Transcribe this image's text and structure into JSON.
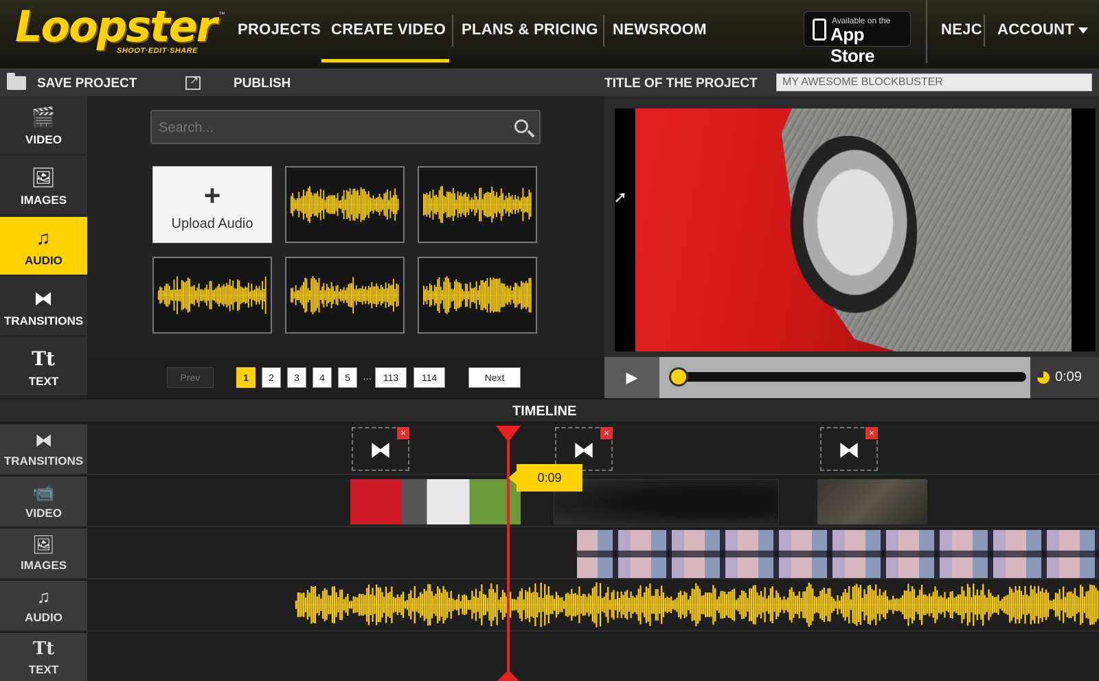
{
  "brand": {
    "logo_text": "Loopster",
    "tagline": "SHOOT·EDIT·SHARE",
    "tm": "™",
    "accent": "#ffd200"
  },
  "nav": {
    "projects": "PROJECTS",
    "create_video": "CREATE VIDEO",
    "plans_pricing": "PLANS & PRICING",
    "newsroom": "NEWSROOM",
    "appstore_small": "Available on the",
    "appstore_big": "App Store",
    "user": "NEJC",
    "account": "ACCOUNT",
    "active": "create_video"
  },
  "toolbar": {
    "save": "SAVE PROJECT",
    "publish": "PUBLISH",
    "title_label": "TITLE OF THE PROJECT",
    "title_value": "MY AWESOME BLOCKBUSTER"
  },
  "sidebar": {
    "items": [
      {
        "label": "VIDEO",
        "icon": "clapperboard-icon",
        "glyph": "🎬"
      },
      {
        "label": "IMAGES",
        "icon": "image-icon",
        "glyph": "🖼"
      },
      {
        "label": "AUDIO",
        "icon": "music-note-icon",
        "glyph": "♫",
        "active": true
      },
      {
        "label": "TRANSITIONS",
        "icon": "bowtie-icon",
        "glyph": "⧓"
      },
      {
        "label": "TEXT",
        "icon": "text-icon",
        "glyph": "Tt"
      }
    ]
  },
  "browser": {
    "search_placeholder": "Search...",
    "upload_plus": "+",
    "upload_label": "Upload Audio",
    "tile_count": 5
  },
  "pager": {
    "prev": "Prev",
    "pages": [
      "1",
      "2",
      "3",
      "4",
      "5"
    ],
    "dots": "...",
    "last_pages": [
      "113",
      "114"
    ],
    "current": "1",
    "next": "Next"
  },
  "player": {
    "play": "▶",
    "progress": 0.0,
    "time": "0:09"
  },
  "timeline": {
    "title": "TIMELINE",
    "tracks": [
      {
        "label": "TRANSITIONS",
        "icon": "bowtie-icon",
        "glyph": "⧓"
      },
      {
        "label": "VIDEO",
        "icon": "video-camera-icon",
        "glyph": "📹"
      },
      {
        "label": "IMAGES",
        "icon": "image-icon",
        "glyph": "🖼"
      },
      {
        "label": "AUDIO",
        "icon": "music-note-icon",
        "glyph": "♫"
      },
      {
        "label": "TEXT",
        "icon": "text-icon",
        "glyph": "Tt"
      }
    ],
    "transition_glyph": "⧓",
    "delete_glyph": "×",
    "playhead_time": "0:09",
    "playhead_color": "#e82020"
  }
}
